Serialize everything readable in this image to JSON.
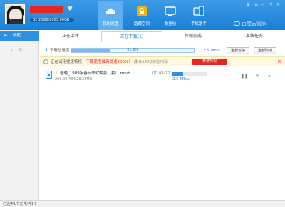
{
  "header": {
    "quota_text": "82.20GB/2055.00GB",
    "vip_icon": "v-icon",
    "brand": "百度云管家",
    "window_controls": [
      "skin-icon",
      "menu-icon",
      "minimize-icon",
      "maximize-icon",
      "close-icon"
    ],
    "nav": [
      {
        "label": "我的网盘",
        "icon": "cloud-icon",
        "active": true
      },
      {
        "label": "隐藏空间",
        "icon": "lock-icon",
        "active": false
      },
      {
        "label": "数据线",
        "icon": "monitor-icon",
        "active": false
      },
      {
        "label": "手机助手",
        "icon": "phone-icon",
        "active": false
      }
    ]
  },
  "sidebar": {
    "collapse_label": "收起",
    "nav_arrows": "‹ › ↻"
  },
  "tabs": [
    {
      "label": "正在上传",
      "active": false
    },
    {
      "label": "正在下载(1)",
      "active": true
    },
    {
      "label": "传输完成",
      "active": false
    },
    {
      "label": "离线任务",
      "active": false
    }
  ],
  "speedbar": {
    "label": "下载总进度",
    "progress_text": "31.9%",
    "progress": 0.319,
    "speed": "2.5 MB/s",
    "pause_all": "全部暂停",
    "cancel_all": "全部取消"
  },
  "notice": {
    "text_prefix": "正在试用提速特权，",
    "text_highlight": "下载速度最高提速200%！",
    "text_sub": "(剩余190秒体验时间)",
    "open_button": "开通特权",
    "close": "×"
  },
  "downloads": [
    {
      "name": "春晚_1989年春节联欢晚会（套）.rmvb",
      "size": "296.08MB/928.32MB",
      "time_left": "00:04:22",
      "progress": 0.319,
      "speed": "2.5 MB/s"
    }
  ],
  "statusbar": {
    "text": "已选中1个文件/共1个"
  },
  "colors": {
    "header_blue": "#1a7fd6",
    "accent_red": "#e8251f",
    "accent_blue": "#2f8fe3"
  }
}
